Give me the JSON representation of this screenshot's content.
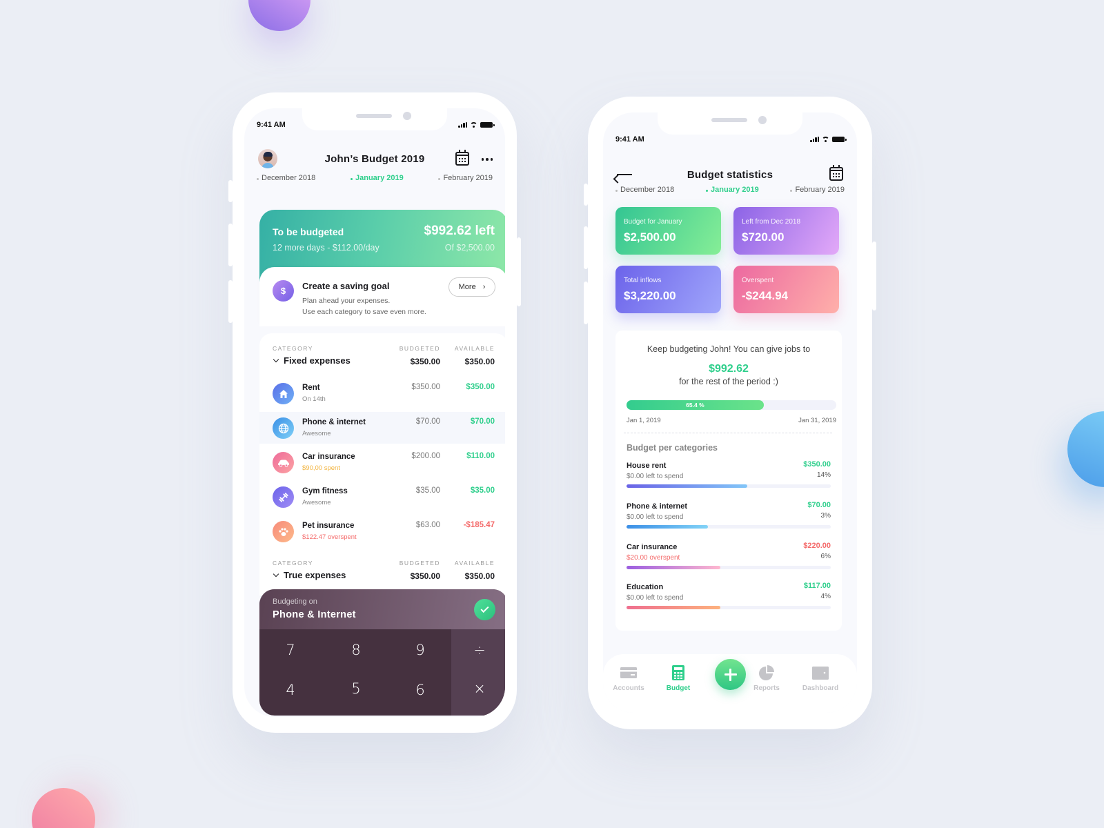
{
  "status_bar": {
    "time": "9:41 AM"
  },
  "left_phone": {
    "header": {
      "title": "John’s Budget 2019"
    },
    "months": [
      {
        "label": "December 2018",
        "active": false
      },
      {
        "label": "January 2019",
        "active": true
      },
      {
        "label": "February 2019",
        "active": false
      }
    ],
    "budget_card": {
      "title": "To be budgeted",
      "subtitle": "12 more days - $112.00/day",
      "amount": "$992.62 left",
      "of_total": "Of $2,500.00"
    },
    "saving_goal": {
      "icon": "money-bag-icon",
      "title": "Create a saving goal",
      "line1": "Plan ahead your expenses.",
      "line2": "Use each category to save even more.",
      "more_label": "More"
    },
    "column_headers": {
      "category": "CATEGORY",
      "budgeted": "BUDGETED",
      "available": "AVAILABLE"
    },
    "groups": [
      {
        "name": "Fixed expenses",
        "budgeted": "$350.00",
        "available": "$350.00"
      },
      {
        "name": "True expenses",
        "budgeted": "$350.00",
        "available": "$350.00"
      }
    ],
    "items": [
      {
        "name": "Rent",
        "sub": "On 14th",
        "sub_color": "gray",
        "budgeted": "$350.00",
        "available": "$350.00",
        "available_color": "green",
        "icon": "home-icon",
        "icon_gradient": [
          "#5a6fe8",
          "#6fb0f5"
        ]
      },
      {
        "name": "Phone & internet",
        "sub": "Awesome",
        "sub_color": "gray",
        "budgeted": "$70.00",
        "available": "$70.00",
        "available_color": "green",
        "icon": "globe-icon",
        "icon_gradient": [
          "#3a8fe6",
          "#7fd0f7"
        ],
        "highlighted": true
      },
      {
        "name": "Car insurance",
        "sub": "$90,00 spent",
        "sub_color": "orange",
        "budgeted": "$200.00",
        "available": "$110.00",
        "available_color": "green",
        "icon": "car-icon",
        "icon_gradient": [
          "#ee6b9a",
          "#fca3a3"
        ]
      },
      {
        "name": "Gym fitness",
        "sub": "Awesome",
        "sub_color": "gray",
        "budgeted": "$35.00",
        "available": "$35.00",
        "available_color": "green",
        "icon": "dumbbell-icon",
        "icon_gradient": [
          "#6c63ea",
          "#9f8cf5"
        ]
      },
      {
        "name": "Pet insurance",
        "sub": "$122.47 overspent",
        "sub_color": "red",
        "budgeted": "$63.00",
        "available": "-$185.47",
        "available_color": "red",
        "icon": "paw-icon",
        "icon_gradient": [
          "#f78b7a",
          "#fdb98a"
        ]
      }
    ],
    "keypad": {
      "label": "Budgeting on",
      "category": "Phone & Internet",
      "keys": [
        "7",
        "8",
        "9",
        "÷",
        "4",
        "5",
        "6",
        "×"
      ]
    }
  },
  "right_phone": {
    "header": {
      "title": "Budget statistics"
    },
    "months": [
      {
        "label": "December 2018",
        "active": false
      },
      {
        "label": "January 2019",
        "active": true
      },
      {
        "label": "February 2019",
        "active": false
      }
    ],
    "stat_cards": [
      {
        "label": "Budget for January",
        "value": "$2,500.00"
      },
      {
        "label": "Left from Dec 2018",
        "value": "$720.00"
      },
      {
        "label": "Total inflows",
        "value": "$3,220.00"
      },
      {
        "label": "Overspent",
        "value": "-$244.94"
      }
    ],
    "summary": {
      "message": "Keep budgeting John! You can give jobs to",
      "amount": "$992.62",
      "message2": "for the rest of the period :)",
      "progress_percent": 65.4,
      "progress_label": "65.4 %",
      "start_date": "Jan 1, 2019",
      "end_date": "Jan 31, 2019"
    },
    "categories_title": "Budget per categories",
    "categories": [
      {
        "name": "House rent",
        "sub": "$0.00 left to spend",
        "sub_color": "gray",
        "amount": "$350.00",
        "amount_color": "green",
        "percent": "14%",
        "fill_fraction": 0.59,
        "gradient": [
          "#6a63e6",
          "#82c6f8"
        ]
      },
      {
        "name": "Phone & internet",
        "sub": "$0.00 left to spend",
        "sub_color": "gray",
        "amount": "$70.00",
        "amount_color": "green",
        "percent": "3%",
        "fill_fraction": 0.4,
        "gradient": [
          "#3b8fe6",
          "#82d3f7"
        ]
      },
      {
        "name": "Car insurance",
        "sub": "$20.00 overspent",
        "sub_color": "red",
        "amount": "$220.00",
        "amount_color": "red",
        "percent": "6%",
        "fill_fraction": 0.46,
        "gradient": [
          "#9b5ee0",
          "#ffb8cf"
        ]
      },
      {
        "name": "Education",
        "sub": "$0.00 left to spend",
        "sub_color": "gray",
        "amount": "$117.00",
        "amount_color": "green",
        "percent": "4%",
        "fill_fraction": 0.46,
        "gradient": [
          "#ef6f8f",
          "#fdb27e"
        ]
      }
    ],
    "tabbar": [
      {
        "label": "Accounts",
        "icon": "card-icon",
        "active": false
      },
      {
        "label": "Budget",
        "icon": "calculator-icon",
        "active": true
      },
      {
        "label": "Reports",
        "icon": "pie-chart-icon",
        "active": false
      },
      {
        "label": "Dashboard",
        "icon": "wallet-icon",
        "active": false
      }
    ],
    "fab_icon": "plus-icon"
  },
  "colors": {
    "accent_green": "#2fcf8c",
    "negative_red": "#f46a6a",
    "warning_orange": "#f2b33d",
    "keypad_bg": "#45313f",
    "background": "#ebeef5"
  }
}
